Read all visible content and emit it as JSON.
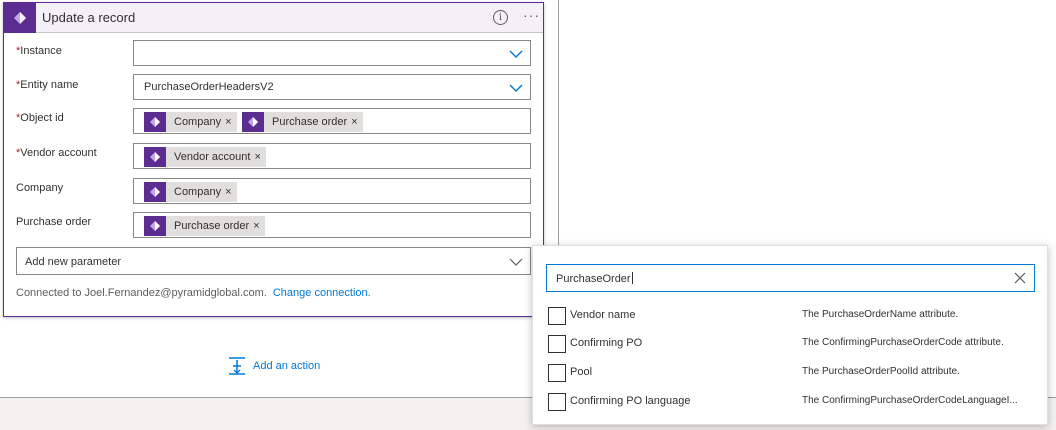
{
  "colors": {
    "accent": "#5c2d91",
    "link": "#0078d4",
    "required": "#a4262c",
    "token_bg": "#e1dfdd"
  },
  "card": {
    "title": "Update a record",
    "icon": "power-apps-icon",
    "fields": {
      "instance": {
        "label": "Instance",
        "required": "*",
        "value": ""
      },
      "entity_name": {
        "label": "Entity name",
        "required": "*",
        "value": "PurchaseOrderHeadersV2"
      },
      "object_id": {
        "label": "Object id",
        "required": "*",
        "tokens": [
          "Company",
          "Purchase order"
        ]
      },
      "vendor_account": {
        "label": "Vendor account",
        "required": "*",
        "tokens": [
          "Vendor account"
        ]
      },
      "company": {
        "label": "Company",
        "tokens": [
          "Company"
        ]
      },
      "purchase_order": {
        "label": "Purchase order",
        "tokens": [
          "Purchase order"
        ]
      }
    },
    "token_remove": "×",
    "add_param_label": "Add new parameter",
    "connected_text": "Connected to Joel.Fernandez@pyramidglobal.com.",
    "change_connection": "Change connection."
  },
  "add_action": {
    "label": "Add an action"
  },
  "dropdown": {
    "search_value": "PurchaseOrder",
    "options": [
      {
        "name": "Vendor name",
        "desc": "The PurchaseOrderName attribute.",
        "checked": false
      },
      {
        "name": "Confirming PO",
        "desc": "The ConfirmingPurchaseOrderCode attribute.",
        "checked": false
      },
      {
        "name": "Pool",
        "desc": "The PurchaseOrderPoolId attribute.",
        "checked": false
      },
      {
        "name": "Confirming PO language",
        "desc": "The ConfirmingPurchaseOrderCodeLanguageI...",
        "checked": false
      }
    ]
  }
}
